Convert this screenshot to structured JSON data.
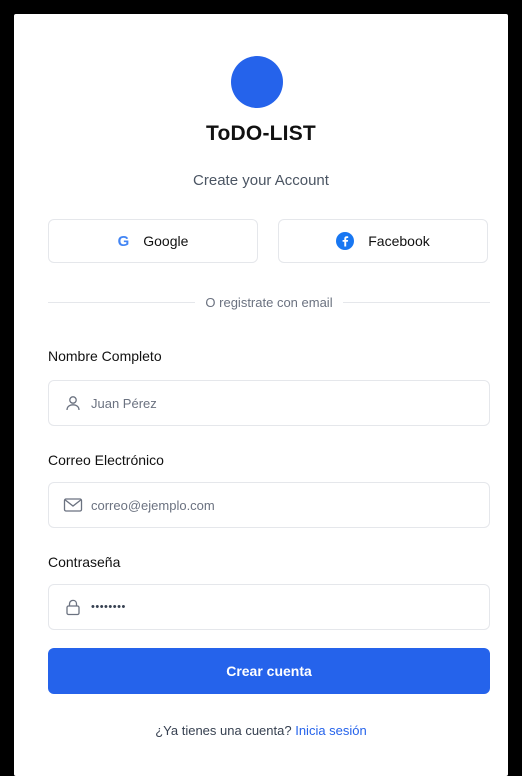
{
  "header": {
    "title": "ToDO-LIST",
    "subtitle": "Create your Account",
    "logo_icon": "blue-circle-logo"
  },
  "social": {
    "google_label": "Google",
    "google_icon": "google-icon",
    "facebook_label": "Facebook",
    "facebook_icon": "facebook-icon"
  },
  "divider": {
    "text": "O registrate con email"
  },
  "form": {
    "name": {
      "label": "Nombre Completo",
      "placeholder": "Juan Pérez",
      "value": "",
      "icon": "user-icon"
    },
    "email": {
      "label": "Correo Electrónico",
      "placeholder": "correo@ejemplo.com",
      "value": "",
      "icon": "mail-icon"
    },
    "password": {
      "label": "Contraseña",
      "masked_value": "••••••••",
      "icon": "lock-icon"
    },
    "submit_label": "Crear cuenta"
  },
  "footer": {
    "question": "¿Ya tienes una cuenta?",
    "link_label": "Inicia sesión"
  },
  "colors": {
    "accent": "#2563eb",
    "border": "#e5e7eb",
    "text": "#111111",
    "muted": "#6b7280",
    "background": "#000000",
    "card": "#ffffff"
  }
}
